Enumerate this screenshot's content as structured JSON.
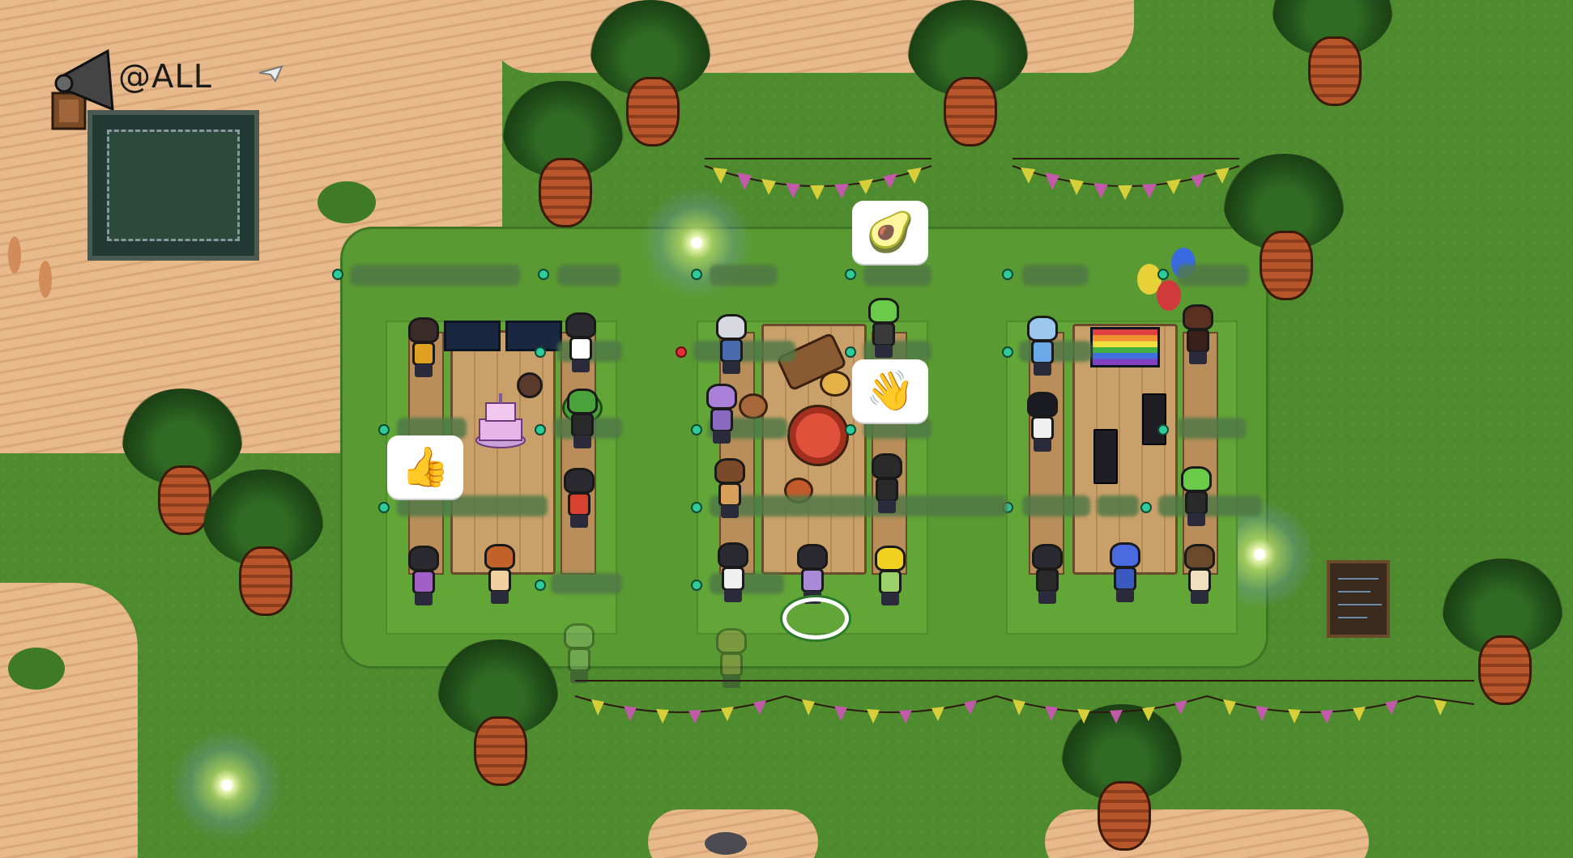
{
  "announcement": {
    "label": "@ALL",
    "icon": "megaphone-icon"
  },
  "reactions": [
    {
      "emoji": "🥑",
      "name": "avocado-icon"
    },
    {
      "emoji": "👋",
      "name": "waving-hand-icon"
    },
    {
      "emoji": "👍",
      "name": "thumbs-up-icon"
    }
  ],
  "colors": {
    "grass": "#4e8b2f",
    "sand": "#e8b98a",
    "water": "#3a8fd6",
    "seat_open": "#2ecc9a",
    "seat_occupied": "#e0303a",
    "self_ring": "#ffffff"
  },
  "map": {
    "occupied_seats": 1
  }
}
